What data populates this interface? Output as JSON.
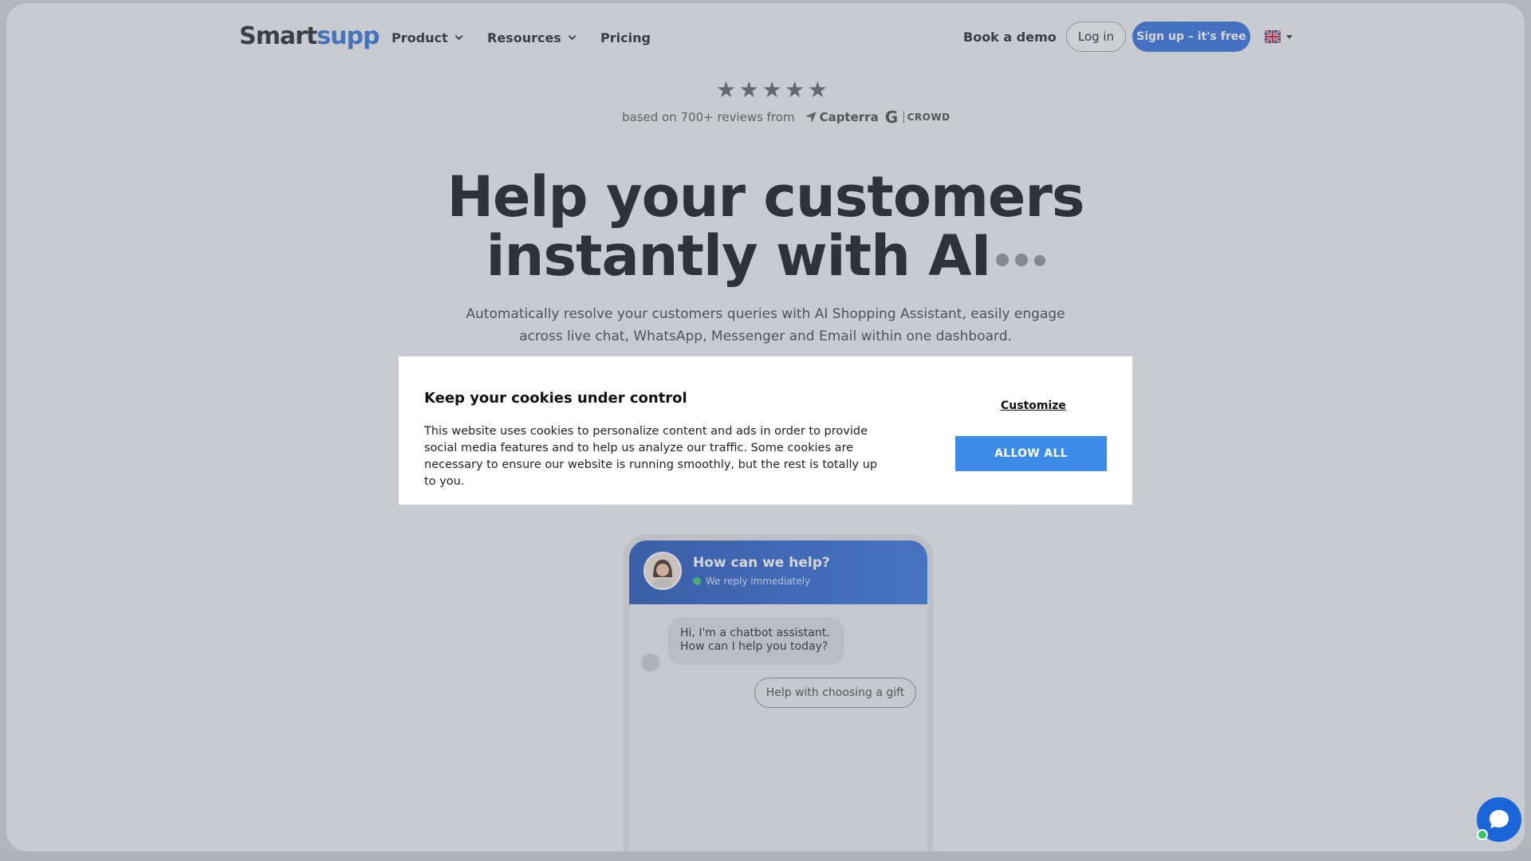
{
  "nav": {
    "logo_part1": "Smart",
    "logo_part2": "supp",
    "items": [
      {
        "label": "Product"
      },
      {
        "label": "Resources"
      },
      {
        "label": "Pricing"
      }
    ],
    "book_demo": "Book a demo",
    "login": "Log in",
    "signup": "Sign up – it's free",
    "language_flag": "uk-flag-icon"
  },
  "rating": {
    "stars": 5,
    "reviews_text": "based on 700+ reviews from",
    "source1": "Capterra",
    "source2": "CROWD"
  },
  "hero": {
    "headline_line1": "Help your customers",
    "headline_line2": "instantly with AI",
    "subtitle": "Automatically resolve your customers queries with AI Shopping Assistant, easily engage across live chat, WhatsApp, Messenger and Email within one dashboard."
  },
  "cookie": {
    "title": "Keep your cookies under control",
    "text": "This website uses cookies to personalize content and ads in order to provide social media features and to help us analyze our traffic. Some cookies are necessary to ensure our website is running smoothly, but the rest is totally up to you.",
    "customize": "Customize",
    "allow_all": "ALLOW ALL"
  },
  "chat_preview": {
    "title": "How can we help?",
    "status": "We reply immediately",
    "bot_message": "Hi, I'm a chatbot assistant. How can I help you today?",
    "quick_reply": "Help with choosing a gift"
  },
  "colors": {
    "brand_blue": "#2c6ce0",
    "allow_button": "#3b8be8",
    "online_green": "#35c46a"
  }
}
